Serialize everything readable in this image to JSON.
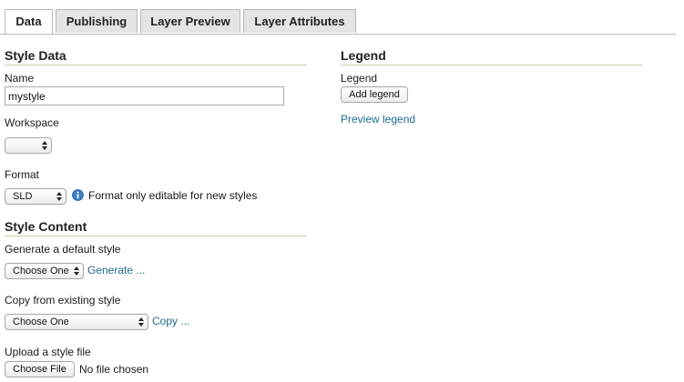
{
  "tabs": [
    {
      "label": "Data",
      "active": true
    },
    {
      "label": "Publishing",
      "active": false
    },
    {
      "label": "Layer Preview",
      "active": false
    },
    {
      "label": "Layer Attributes",
      "active": false
    }
  ],
  "style_data": {
    "title": "Style Data",
    "name_label": "Name",
    "name_value": "mystyle",
    "workspace_label": "Workspace",
    "workspace_value": "",
    "format_label": "Format",
    "format_value": "SLD",
    "format_note": "Format only editable for new styles",
    "info_icon": "info-icon"
  },
  "style_content": {
    "title": "Style Content",
    "generate_label": "Generate a default style",
    "generate_select": "Choose One",
    "generate_link": "Generate ...",
    "copy_label": "Copy from existing style",
    "copy_select": "Choose One",
    "copy_link": "Copy ...",
    "upload_label": "Upload a style file",
    "upload_button": "Choose File",
    "upload_status": "No file chosen"
  },
  "legend": {
    "title": "Legend",
    "legend_label": "Legend",
    "add_button": "Add legend",
    "preview_link": "Preview legend"
  },
  "colors": {
    "link": "#1f6a8c",
    "section_rule": "#c9d3a3",
    "info_icon": "#3b7fc4"
  }
}
